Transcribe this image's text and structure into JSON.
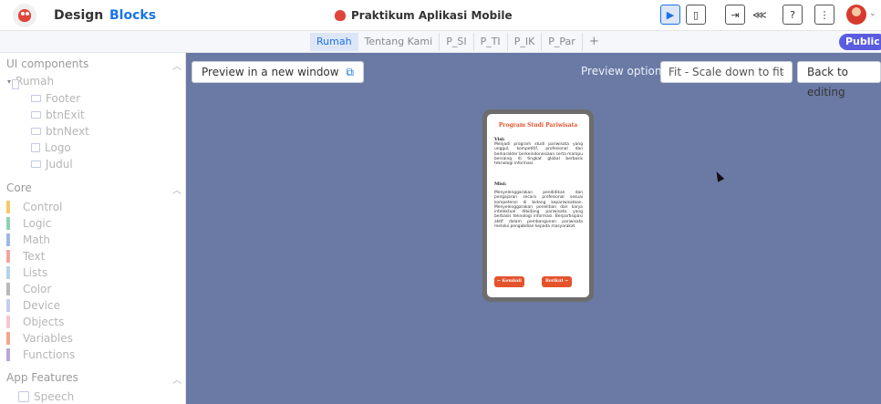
{
  "header": {
    "tabs": [
      "Design",
      "Blocks"
    ],
    "active_tab": "Blocks",
    "project_name": "Praktikum Aplikasi Mobile",
    "icons": [
      "logo-icon",
      "preview-icon",
      "phone-icon",
      "export-icon",
      "share-icon",
      "help-icon",
      "more-icon",
      "avatar",
      "chevron-down-icon"
    ]
  },
  "screen_tabs": {
    "items": [
      "Rumah",
      "Tentang Kami",
      "P_SI",
      "P_TI",
      "P_IK",
      "P_Par"
    ],
    "active": "Rumah",
    "add": "+",
    "public_label": "Public"
  },
  "sidebar": {
    "ui_components": {
      "title": "UI components",
      "root": "Rumah",
      "items": [
        "Footer",
        "btnExit",
        "btnNext",
        "Logo",
        "Judul"
      ]
    },
    "core": {
      "title": "Core",
      "items": [
        {
          "label": "Control",
          "color": "#f6c86a"
        },
        {
          "label": "Logic",
          "color": "#8fd1b5"
        },
        {
          "label": "Math",
          "color": "#9fb6e8"
        },
        {
          "label": "Text",
          "color": "#f4a3a3"
        },
        {
          "label": "Lists",
          "color": "#b4d4e8"
        },
        {
          "label": "Color",
          "color": "#b9b9b9"
        },
        {
          "label": "Device",
          "color": "#c6cdf2"
        },
        {
          "label": "Objects",
          "color": "#f6c6cf"
        },
        {
          "label": "Variables",
          "color": "#f4a58e"
        },
        {
          "label": "Functions",
          "color": "#b6a8d8"
        }
      ]
    },
    "app_features": {
      "title": "App Features",
      "items": [
        "Speech"
      ]
    }
  },
  "workspace": {
    "preview_button": "Preview in a new window",
    "preview_options_label": "Preview options",
    "scale_select": "Fit - Scale down to fit",
    "back_button": "Back to editing",
    "background": "#6a7aa5"
  },
  "phone": {
    "title": "Program Studi Pariwisata",
    "visi_head": "Visi:",
    "visi_text": "Menjadi program studi pariwisata yang unggul, kompetitif, profesional dan berkarakter berkeindonesiaan serta mampu bersaing di tingkat global berbasis teknologi informasi.",
    "misi_head": "Misi:",
    "misi_text": "Menyelenggarakan pendidikan dan pengajaran secara profesional sesuai kompetensi di bidang kepariwisataan. Menyelenggarakan penelitian dan karya intelektual dibidang pariwisata yang berbasis teknologi informasi. Berpartisipasi aktif dalam pembangunan pariwisata melalui pengabdian kepada masyarakat.",
    "back_btn": "← Kembali",
    "next_btn": "Berikut →",
    "accent": "#e5532c"
  }
}
